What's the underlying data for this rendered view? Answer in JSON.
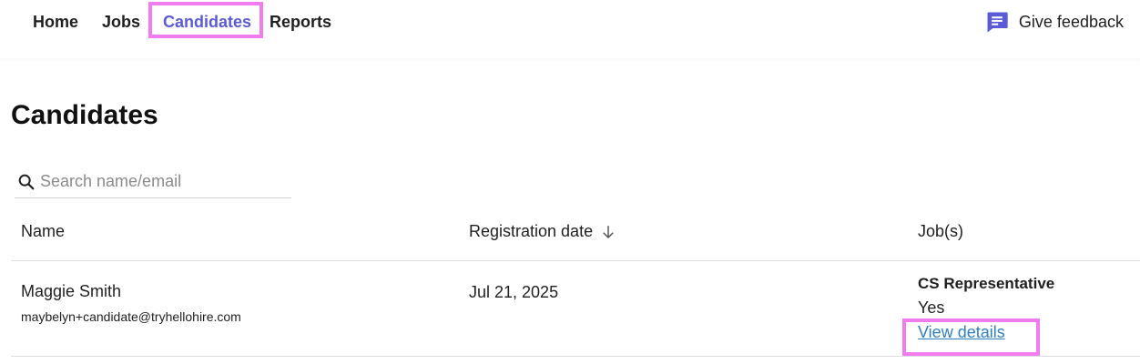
{
  "nav": {
    "items": [
      {
        "label": "Home"
      },
      {
        "label": "Jobs"
      },
      {
        "label": "Candidates",
        "active": true
      },
      {
        "label": "Reports"
      }
    ],
    "feedback_label": "Give feedback",
    "feedback_icon": "chat-bubble-icon"
  },
  "page": {
    "title": "Candidates"
  },
  "search": {
    "placeholder": "Search name/email",
    "value": ""
  },
  "table": {
    "columns": [
      {
        "label": "Name"
      },
      {
        "label": "Registration date",
        "sort": "descending"
      },
      {
        "label": "Job(s)"
      }
    ],
    "rows": [
      {
        "name": "Maggie Smith",
        "email": "maybelyn+candidate@tryhellohire.com",
        "registration_date": "Jul 21, 2025",
        "job_title": "CS Representative",
        "job_status": "Yes",
        "details_link": "View details"
      }
    ]
  },
  "colors": {
    "accent": "#5b5bd6",
    "link": "#2f7fc1",
    "highlight": "#f07cf0"
  }
}
